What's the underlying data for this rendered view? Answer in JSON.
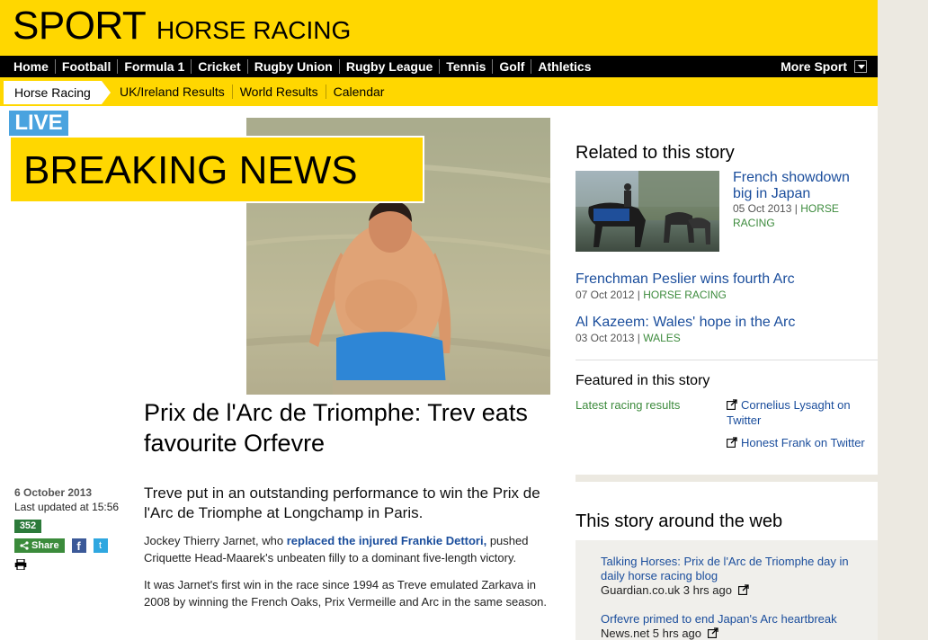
{
  "header": {
    "sport": "SPORT",
    "section": "HORSE RACING"
  },
  "main_nav": {
    "items": [
      "Home",
      "Football",
      "Formula 1",
      "Cricket",
      "Rugby Union",
      "Rugby League",
      "Tennis",
      "Golf",
      "Athletics"
    ],
    "more": "More Sport"
  },
  "sub_nav": {
    "active": "Horse Racing",
    "items": [
      "UK/Ireland Results",
      "World Results",
      "Calendar"
    ]
  },
  "banner": {
    "live": "LIVE",
    "breaking": "BREAKING",
    "news": "NEWS"
  },
  "article": {
    "headline": "Prix de l'Arc de Triomphe: Trev eats favourite Orfevre",
    "date": "6 October 2013",
    "updated": "Last updated at 15:56",
    "comments": "352",
    "share": "Share",
    "intro": "Treve put in an outstanding performance to win the Prix de l'Arc de Triomphe at Longchamp in Paris.",
    "para1_pre": "Jockey Thierry Jarnet, who ",
    "para1_link": "replaced the injured Frankie Dettori,",
    "para1_post": " pushed Criquette Head-Maarek's unbeaten filly to a dominant five-length victory.",
    "para2": "It was Jarnet's first win in the race since 1994 as Treve emulated Zarkava in 2008 by winning the French Oaks, Prix Vermeille and Arc in the same season."
  },
  "related": {
    "title": "Related to this story",
    "items": [
      {
        "title": "French showdown big in Japan",
        "date": "05 Oct 2013",
        "tag": "HORSE RACING"
      },
      {
        "title": "Frenchman Peslier wins fourth Arc",
        "date": "07 Oct 2012",
        "tag": "HORSE RACING"
      },
      {
        "title": "Al Kazeem: Wales' hope in the Arc",
        "date": "03 Oct 2013",
        "tag": "WALES"
      }
    ]
  },
  "featured": {
    "title": "Featured in this story",
    "left": "Latest racing results",
    "links": [
      "Cornelius Lysaght on Twitter",
      "Honest Frank on Twitter"
    ]
  },
  "web": {
    "title": "This story around the web",
    "items": [
      {
        "title": "Talking Horses: Prix de l'Arc de Triomphe day in daily horse racing blog",
        "source": "Guardian.co.uk 3 hrs ago"
      },
      {
        "title": "Orfevre primed to end Japan's Arc heartbreak",
        "source": "News.net 5 hrs ago"
      }
    ]
  },
  "colors": {
    "yellow": "#ffd700",
    "black": "#000000",
    "link": "#1a4d9c",
    "green": "#3d8b3d",
    "live_blue": "#4aa3df"
  }
}
